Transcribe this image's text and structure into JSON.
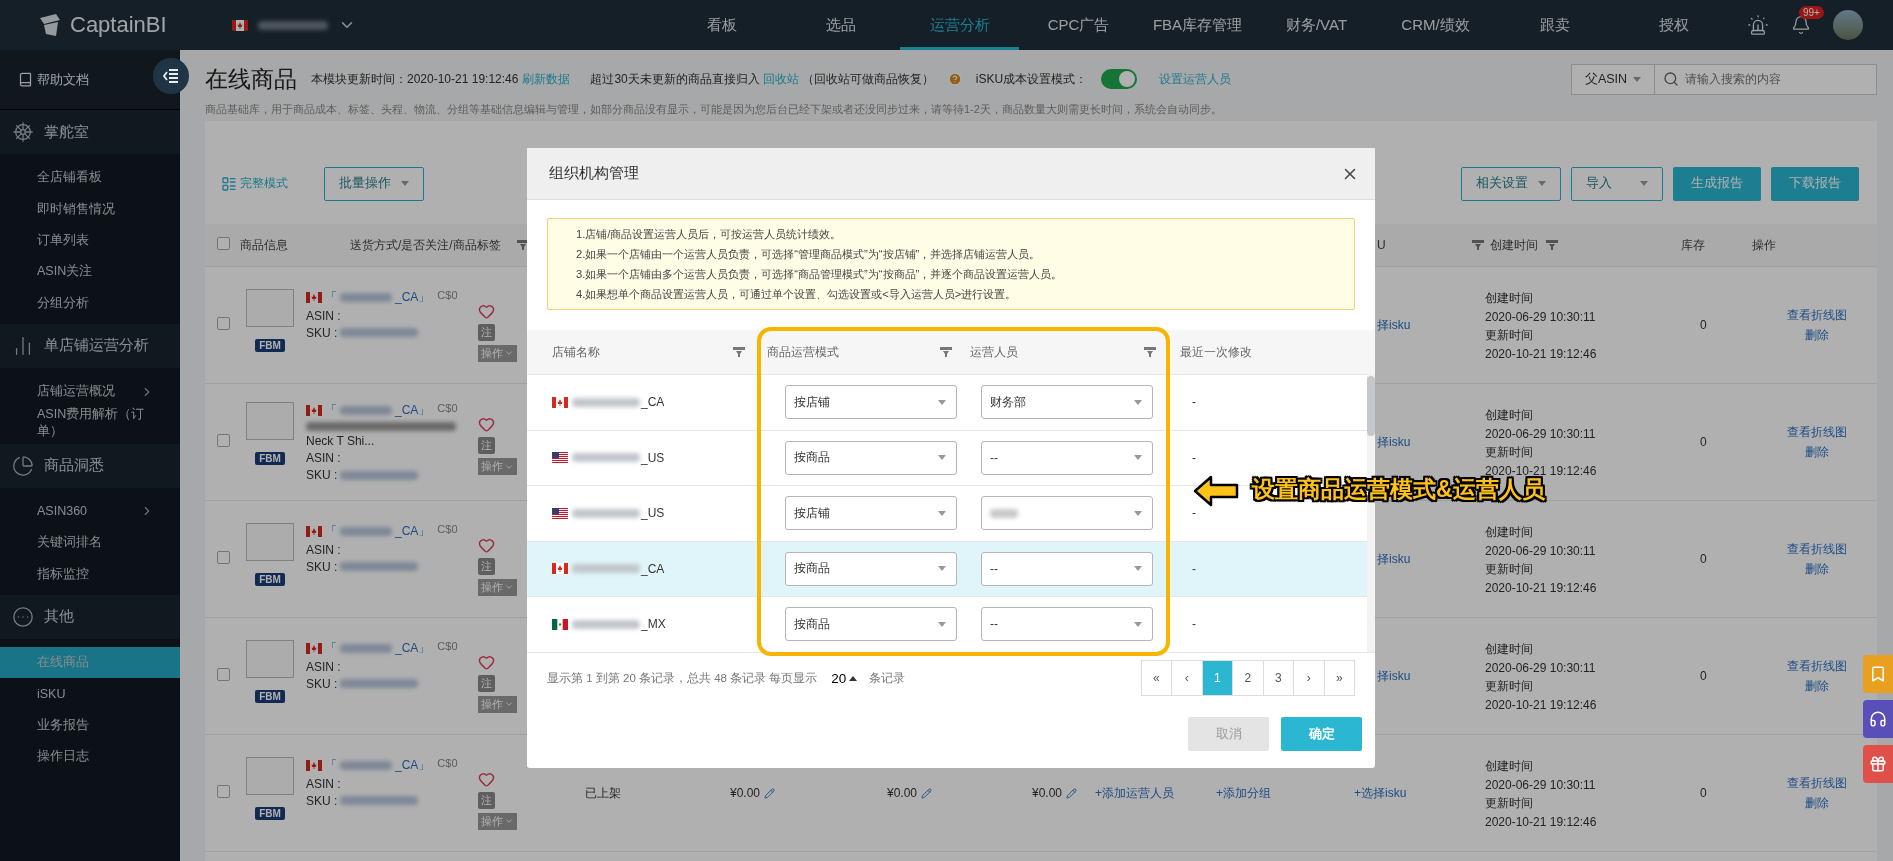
{
  "header": {
    "logo": "CaptainBI",
    "notification_badge": "99+",
    "nav": [
      {
        "label": "看板",
        "selected": false
      },
      {
        "label": "选品",
        "selected": false
      },
      {
        "label": "运营分析",
        "selected": true
      },
      {
        "label": "CPC广告",
        "selected": false
      },
      {
        "label": "FBA库存管理",
        "selected": false
      },
      {
        "label": "财务/VAT",
        "selected": false
      },
      {
        "label": "CRM/绩效",
        "selected": false
      },
      {
        "label": "跟卖",
        "selected": false
      },
      {
        "label": "授权",
        "selected": false
      }
    ]
  },
  "sidebar": {
    "help": "帮助文档",
    "groups": [
      {
        "kind": "helm",
        "label": "掌舵室",
        "items": [
          {
            "label": "全店铺看板",
            "selected": false,
            "submenu": false
          },
          {
            "label": "即时销售情况",
            "selected": false,
            "submenu": false
          },
          {
            "label": "订单列表",
            "selected": false,
            "submenu": false
          },
          {
            "label": "ASIN关注",
            "selected": false,
            "submenu": false
          },
          {
            "label": "分组分析",
            "selected": false,
            "submenu": false
          }
        ]
      },
      {
        "kind": "bars",
        "label": "单店铺运营分析",
        "items": [
          {
            "label": "店铺运营概况",
            "selected": false,
            "submenu": true
          },
          {
            "label": "ASIN费用解析（订单）",
            "selected": false,
            "submenu": false
          }
        ]
      },
      {
        "kind": "pie",
        "label": "商品洞悉",
        "items": [
          {
            "label": "ASIN360",
            "selected": false,
            "submenu": true
          },
          {
            "label": "关键词排名",
            "selected": false,
            "submenu": false
          },
          {
            "label": "指标监控",
            "selected": false,
            "submenu": false
          }
        ]
      },
      {
        "kind": "more",
        "label": "其他",
        "items": [
          {
            "label": "在线商品",
            "selected": true,
            "submenu": false
          },
          {
            "label": "iSKU",
            "selected": false,
            "submenu": false
          },
          {
            "label": "业务报告",
            "selected": false,
            "submenu": false
          },
          {
            "label": "操作日志",
            "selected": false,
            "submenu": false
          }
        ]
      }
    ]
  },
  "page": {
    "title": "在线商品",
    "update_label": "本模块更新时间：2020-10-21 19:12:46",
    "refresh_link": "刷新数据",
    "recycle_prefix": "超过30天未更新的商品直接归入",
    "recycle_link": "回收站",
    "recycle_suffix": "（回收站可做商品恢复）",
    "isku_mode_label": "iSKU成本设置模式：",
    "isku_mode_on": true,
    "set_operator_link": "设置运营人员",
    "description": "商品基础库，用于商品成本、标签、头程、物流、分组等基础信息编辑与管理，如部分商品没有显示，可能是因为您后台已经下架或者还没同步过来，请等待1-2天，商品数量大则需更长时间，系统会自动同步。",
    "search_type": "父ASIN",
    "search_placeholder": "请输入搜索的内容"
  },
  "toolbar": {
    "view_mode": "完整模式",
    "batch": "批量操作",
    "buttons": [
      {
        "label": "相关设置",
        "kind": "dropdown"
      },
      {
        "label": "导入",
        "kind": "dropdown"
      },
      {
        "label": "生成报告",
        "kind": "primary"
      },
      {
        "label": "下载报告",
        "kind": "primary"
      }
    ]
  },
  "table": {
    "select_all_checked": false,
    "columns": [
      {
        "label": "商品信息",
        "filter": false
      },
      {
        "label": "送货方式/是否关注/商品标签",
        "filter": true
      },
      {
        "label": "U",
        "filter": true
      },
      {
        "label": "创建时间",
        "filter": true
      },
      {
        "label": "库存",
        "filter": false
      },
      {
        "label": "操作",
        "filter": false
      }
    ],
    "rows": [
      {
        "checked": false,
        "kind": "ca",
        "store_prefix": "「",
        "store_suffix": "_CA」",
        "price": "C$0",
        "title": "",
        "asin_label": "ASIN :",
        "sku_label": "SKU :",
        "badge": "FBM",
        "tag": "注",
        "ops": "操作",
        "isku": "择isku",
        "created_label": "创建时间",
        "created": "2020-06-29 10:30:11",
        "updated_label": "更新时间",
        "updated": "2020-10-21 19:12:46",
        "stock": "0",
        "actions": [
          "查看折线图",
          "删除"
        ]
      },
      {
        "checked": false,
        "kind": "ca",
        "store_prefix": "「",
        "store_suffix": "_CA」",
        "price": "C$0",
        "title": "Neck T Shi...",
        "asin_label": "ASIN :",
        "sku_label": "SKU :",
        "badge": "FBM",
        "tag": "注",
        "ops": "操作",
        "isku": "择isku",
        "created_label": "创建时间",
        "created": "2020-06-29 10:30:11",
        "updated_label": "更新时间",
        "updated": "2020-10-21 19:12:46",
        "stock": "0",
        "actions": [
          "查看折线图",
          "删除"
        ]
      },
      {
        "checked": false,
        "kind": "ca",
        "store_prefix": "「",
        "store_suffix": "_CA」",
        "price": "C$0",
        "title": "",
        "asin_label": "ASIN :",
        "sku_label": "SKU :",
        "badge": "FBM",
        "tag": "注",
        "ops": "操作",
        "isku": "择isku",
        "created_label": "创建时间",
        "created": "2020-06-29 10:30:11",
        "updated_label": "更新时间",
        "updated": "2020-10-21 19:12:46",
        "stock": "0",
        "actions": [
          "查看折线图",
          "删除"
        ]
      },
      {
        "checked": false,
        "kind": "ca",
        "store_prefix": "「",
        "store_suffix": "_CA」",
        "price": "C$0",
        "title": "",
        "asin_label": "ASIN :",
        "sku_label": "SKU :",
        "badge": "FBM",
        "tag": "注",
        "ops": "操作",
        "isku": "择isku",
        "created_label": "创建时间",
        "created": "2020-06-29 10:30:11",
        "updated_label": "更新时间",
        "updated": "2020-10-21 19:12:46",
        "stock": "0",
        "actions": [
          "查看折线图",
          "删除"
        ]
      },
      {
        "checked": false,
        "kind": "ca",
        "store_prefix": "「",
        "store_suffix": "_CA」",
        "price": "C$0",
        "title": "",
        "asin_label": "ASIN :",
        "sku_label": "SKU :",
        "badge": "FBM",
        "tag": "注",
        "ops": "操作",
        "status": "已上架",
        "prices": [
          "¥0.00",
          "¥0.00",
          "¥0.00"
        ],
        "add_operator": "+添加运营人员",
        "add_group": "+添加分组",
        "isku": "+选择isku",
        "created_label": "创建时间",
        "created": "2020-06-29 10:30:11",
        "updated_label": "更新时间",
        "updated": "2020-10-21 19:12:46",
        "stock": "0",
        "actions": [
          "查看折线图",
          "删除"
        ]
      }
    ]
  },
  "modal": {
    "title": "组织机构管理",
    "notes": [
      "1.店铺/商品设置运营人员后，可按运营人员统计绩效。",
      "2.如果一个店铺由一个运营人员负责，可选择“管理商品模式”为“按店铺”，并选择店铺运营人员。",
      "3.如果一个店铺由多个运营人员负责，可选择“商品管理模式”为“按商品”，并逐个商品设置运营人员。",
      "4.如果想单个商品设置运营人员，可通过单个设置、勾选设置或<导入运营人员>进行设置。"
    ],
    "columns": [
      {
        "label": "店铺名称",
        "filter": true
      },
      {
        "label": "商品运营模式",
        "filter": true
      },
      {
        "label": "运营人员",
        "filter": true
      },
      {
        "label": "最近一次修改",
        "filter": false
      }
    ],
    "rows": [
      {
        "kind": "ca",
        "store_suffix": "_CA",
        "mode": "按店铺",
        "operator": "财务部",
        "operator_blurred": false,
        "last_modified": "-",
        "highlighted": false
      },
      {
        "kind": "us",
        "store_suffix": "_US",
        "mode": "按商品",
        "operator": "--",
        "operator_blurred": false,
        "last_modified": "-",
        "highlighted": false
      },
      {
        "kind": "us",
        "store_suffix": "_US",
        "mode": "按店铺",
        "operator_blurred": true,
        "last_modified": "-",
        "highlighted": false
      },
      {
        "kind": "ca",
        "store_suffix": "_CA",
        "mode": "按商品",
        "operator": "--",
        "operator_blurred": false,
        "last_modified": "-",
        "highlighted": true
      },
      {
        "kind": "mx",
        "store_suffix": "_MX",
        "mode": "按商品",
        "operator": "--",
        "operator_blurred": false,
        "last_modified": "-",
        "highlighted": false
      }
    ],
    "pagination": {
      "summary": "显示第 1 到第 20 条记录，总共 48 条记录 每页显示",
      "page_size": "20",
      "unit": "条记录",
      "pages": [
        {
          "label": "«",
          "selected": false
        },
        {
          "label": "‹",
          "selected": false
        },
        {
          "label": "1",
          "selected": true
        },
        {
          "label": "2",
          "selected": false
        },
        {
          "label": "3",
          "selected": false
        },
        {
          "label": "›",
          "selected": false
        },
        {
          "label": "»",
          "selected": false
        }
      ]
    },
    "cancel": {
      "label": "取消",
      "disabled": true
    },
    "confirm": {
      "label": "确定"
    }
  },
  "annotation": {
    "text": "设置商品运营模式&运营人员"
  }
}
